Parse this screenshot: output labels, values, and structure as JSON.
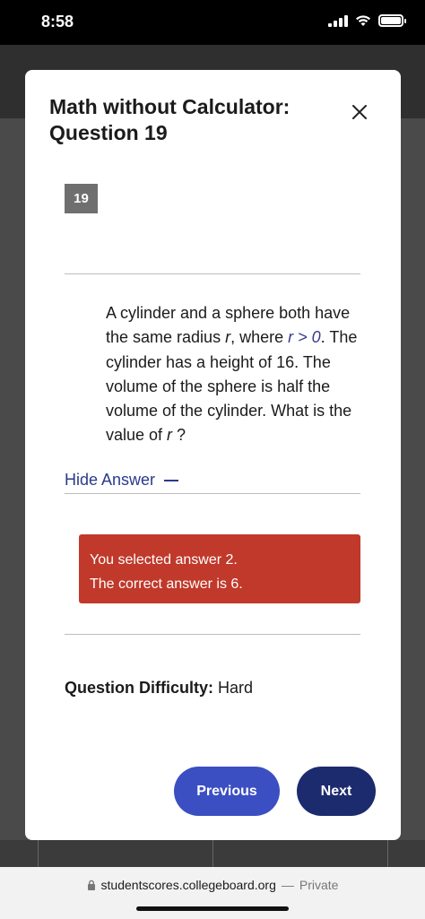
{
  "status": {
    "time": "8:58"
  },
  "modal": {
    "title": "Math without Calculator: Question 19",
    "question_number": "19",
    "question_text": {
      "part1": "A cylinder and a sphere both have the same radius ",
      "r1": "r",
      "part2": ", where ",
      "math_expr": "r > 0",
      "part3": ". The cylinder has a height of 16. The volume of the sphere is half the volume of the cylinder. What is the value of ",
      "r2": "r",
      "part4": " ?"
    },
    "hide_answer_label": "Hide Answer",
    "answer": {
      "selected": "You selected answer 2.",
      "correct": "The correct answer is 6."
    },
    "difficulty": {
      "label": "Question Difficulty:",
      "value": "Hard"
    },
    "buttons": {
      "previous": "Previous",
      "next": "Next"
    }
  },
  "browser": {
    "domain": "studentscores.collegeboard.org",
    "separator": "—",
    "mode": "Private"
  },
  "colors": {
    "answer_bg": "#c0392b",
    "previous_bg": "#3b4fc2",
    "next_bg": "#1c2a6e",
    "link": "#2a3a8c"
  }
}
